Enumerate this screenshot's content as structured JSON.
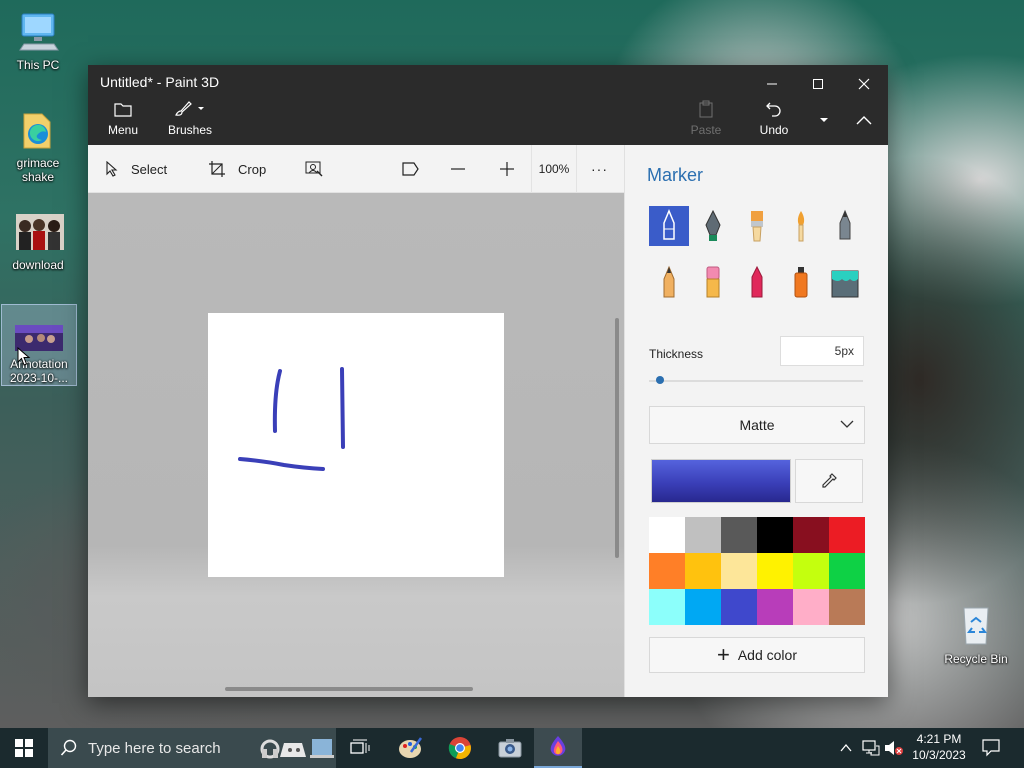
{
  "desktop": {
    "icons": [
      {
        "label": "This PC"
      },
      {
        "label": "grimace shake"
      },
      {
        "label": "download"
      },
      {
        "label": "Annotation 2023-10-..."
      },
      {
        "label": "Recycle Bin"
      }
    ]
  },
  "window": {
    "title": "Untitled* - Paint 3D",
    "ribbon": {
      "menu": "Menu",
      "brushes": "Brushes",
      "paste": "Paste",
      "undo": "Undo"
    }
  },
  "toolbar": {
    "select": "Select",
    "crop": "Crop",
    "zoom": "100%",
    "more": "···"
  },
  "panel": {
    "title": "Marker",
    "thickness_label": "Thickness",
    "thickness_value": "5px",
    "thickness_fraction": 0.05,
    "finish": "Matte",
    "current_color": "#3a3fb8",
    "add_color": "Add color",
    "palette": [
      "#ffffff",
      "#c0c0c0",
      "#595959",
      "#000000",
      "#880f1f",
      "#ec1c24",
      "#ff7f27",
      "#ffc20e",
      "#fde699",
      "#fff200",
      "#c4ff0e",
      "#0ed145",
      "#8cfffb",
      "#00a8f3",
      "#3f48cc",
      "#b83dba",
      "#ffaec8",
      "#b97a57"
    ]
  },
  "taskbar": {
    "search_placeholder": "Type here to search",
    "time": "4:21 PM",
    "date": "10/3/2023"
  }
}
